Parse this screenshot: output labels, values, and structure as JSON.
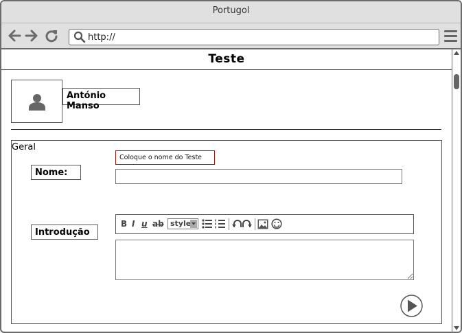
{
  "window": {
    "title": "Portugol"
  },
  "browser": {
    "url": "http://"
  },
  "page": {
    "title": "Teste"
  },
  "user": {
    "name": "António Manso"
  },
  "form": {
    "section_title": "Geral",
    "name_hint": "Coloque o nome do Teste",
    "name_label": "Nome:",
    "name_value": "",
    "intro_label": "Introdução",
    "intro_value": ""
  },
  "editor_toolbar": {
    "bold": "B",
    "italic": "I",
    "underline": "u",
    "strike": "ab",
    "style_select": "style"
  },
  "icons": {
    "back": "arrow-left-icon",
    "forward": "arrow-right-icon",
    "reload": "reload-icon",
    "search": "search-icon",
    "menu": "hamburger-menu-icon",
    "avatar": "user-icon",
    "play": "play-icon"
  },
  "colors": {
    "chrome": "#e0e0e0",
    "border": "#6b6b6b",
    "hint_border": "#a31515"
  }
}
